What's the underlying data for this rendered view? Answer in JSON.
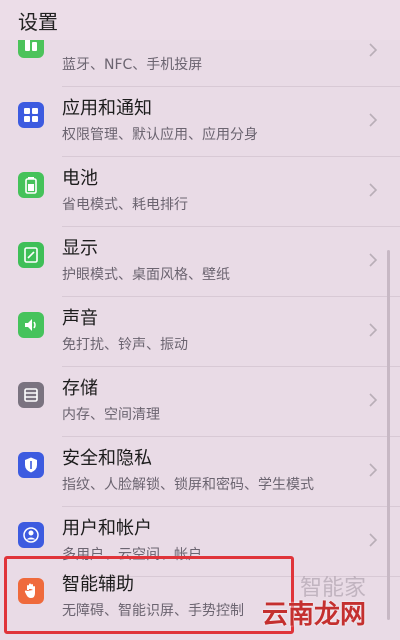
{
  "header": {
    "title": "设置"
  },
  "items": [
    {
      "name": "",
      "sub": "蓝牙、NFC、手机投屏",
      "icon": "device-connection-icon",
      "color": "#4cc35b"
    },
    {
      "name": "应用和通知",
      "sub": "权限管理、默认应用、应用分身",
      "icon": "apps-grid-icon",
      "color": "#3d5be0"
    },
    {
      "name": "电池",
      "sub": "省电模式、耗电排行",
      "icon": "battery-icon",
      "color": "#45c25a"
    },
    {
      "name": "显示",
      "sub": "护眼模式、桌面风格、壁纸",
      "icon": "display-icon",
      "color": "#3fbf58"
    },
    {
      "name": "声音",
      "sub": "免打扰、铃声、振动",
      "icon": "speaker-icon",
      "color": "#46c35c"
    },
    {
      "name": "存储",
      "sub": "内存、空间清理",
      "icon": "storage-icon",
      "color": "#7a7380"
    },
    {
      "name": "安全和隐私",
      "sub": "指纹、人脸解锁、锁屏和密码、学生模式",
      "icon": "shield-icon",
      "color": "#3d5be0"
    },
    {
      "name": "用户和帐户",
      "sub": "多用户、云空间、帐户",
      "icon": "user-icon",
      "color": "#3d5be0"
    },
    {
      "name": "智能辅助",
      "sub": "无障碍、智能识屏、手势控制",
      "icon": "hand-icon",
      "color": "#ef6a3c"
    }
  ],
  "watermark": {
    "text": "云南龙网",
    "faint": "智能家"
  }
}
